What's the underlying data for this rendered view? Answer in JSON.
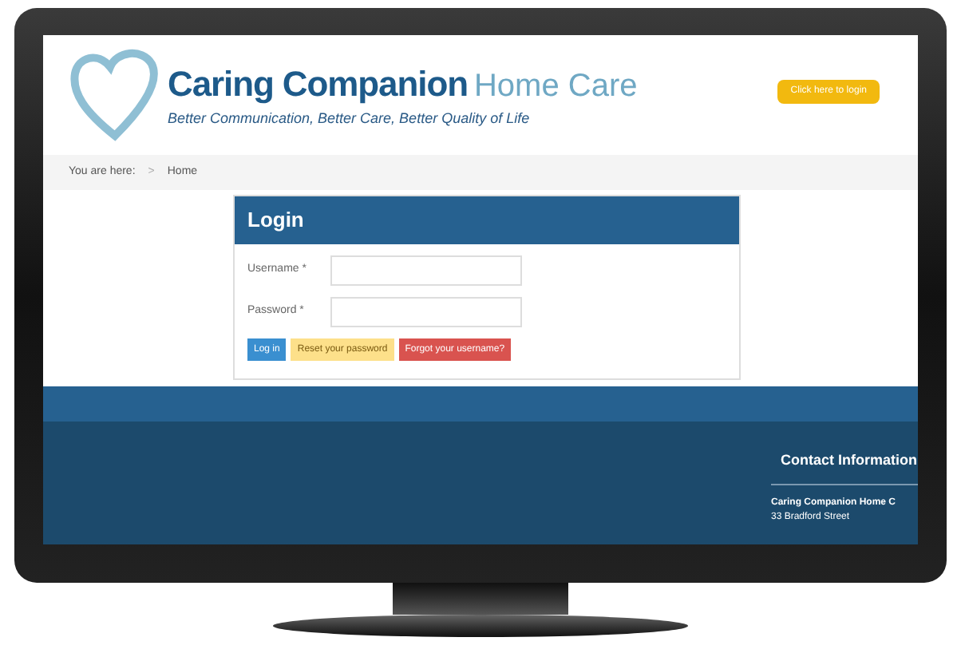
{
  "header": {
    "brand_main": "Caring Companion",
    "brand_sub": "Home Care",
    "tagline": "Better Communication, Better Care, Better Quality of Life",
    "login_link": "Click here to login"
  },
  "breadcrumb": {
    "label": "You are here:",
    "separator": ">",
    "current": "Home"
  },
  "login": {
    "title": "Login",
    "fields": [
      {
        "label": "Username *"
      },
      {
        "label": "Password *"
      }
    ],
    "buttons": [
      {
        "label": "Log in",
        "kind": "primary"
      },
      {
        "label": "Reset your password",
        "kind": "warning"
      },
      {
        "label": "Forgot your username?",
        "kind": "danger"
      }
    ]
  },
  "footer": {
    "heading": "Contact Information",
    "lines": [
      "Caring Companion Home C",
      "33 Bradford Street"
    ]
  }
}
